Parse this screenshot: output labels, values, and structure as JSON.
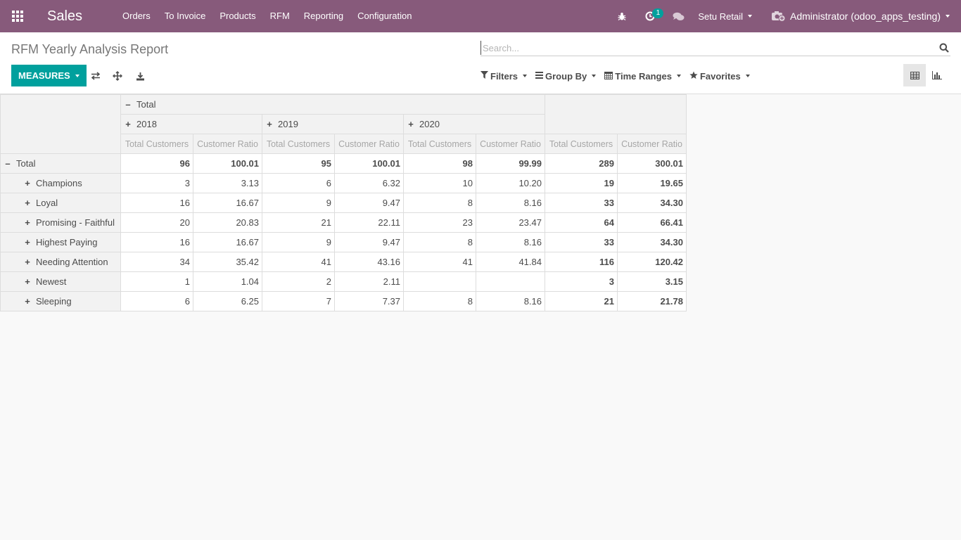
{
  "navbar": {
    "app_name": "Sales",
    "menu": [
      "Orders",
      "To Invoice",
      "Products",
      "RFM",
      "Reporting",
      "Configuration"
    ],
    "badge_count": "1",
    "company": "Setu Retail",
    "user": "Administrator (odoo_apps_testing)"
  },
  "control": {
    "title": "RFM Yearly Analysis Report",
    "search_placeholder": "Search...",
    "measures_label": "MEASURES",
    "filters_label": "Filters",
    "groupby_label": "Group By",
    "timeranges_label": "Time Ranges",
    "favorites_label": "Favorites"
  },
  "pivot": {
    "col_total": "Total",
    "years": [
      "2018",
      "2019",
      "2020"
    ],
    "measures": [
      "Total Customers",
      "Customer Ratio"
    ],
    "row_total": {
      "label": "Total",
      "values": [
        "96",
        "100.01",
        "95",
        "100.01",
        "98",
        "99.99",
        "289",
        "300.01"
      ]
    },
    "rows": [
      {
        "label": "Champions",
        "values": [
          "3",
          "3.13",
          "6",
          "6.32",
          "10",
          "10.20",
          "19",
          "19.65"
        ]
      },
      {
        "label": "Loyal",
        "values": [
          "16",
          "16.67",
          "9",
          "9.47",
          "8",
          "8.16",
          "33",
          "34.30"
        ]
      },
      {
        "label": "Promising - Faithful",
        "values": [
          "20",
          "20.83",
          "21",
          "22.11",
          "23",
          "23.47",
          "64",
          "66.41"
        ]
      },
      {
        "label": "Highest Paying",
        "values": [
          "16",
          "16.67",
          "9",
          "9.47",
          "8",
          "8.16",
          "33",
          "34.30"
        ]
      },
      {
        "label": "Needing Attention",
        "values": [
          "34",
          "35.42",
          "41",
          "43.16",
          "41",
          "41.84",
          "116",
          "120.42"
        ]
      },
      {
        "label": "Newest",
        "values": [
          "1",
          "1.04",
          "2",
          "2.11",
          "",
          "",
          "3",
          "3.15"
        ]
      },
      {
        "label": "Sleeping",
        "values": [
          "6",
          "6.25",
          "7",
          "7.37",
          "8",
          "8.16",
          "21",
          "21.78"
        ]
      }
    ]
  },
  "colors": {
    "navbar": "#875a7b",
    "primary_button": "#00a09d",
    "badge": "#00a09d"
  }
}
